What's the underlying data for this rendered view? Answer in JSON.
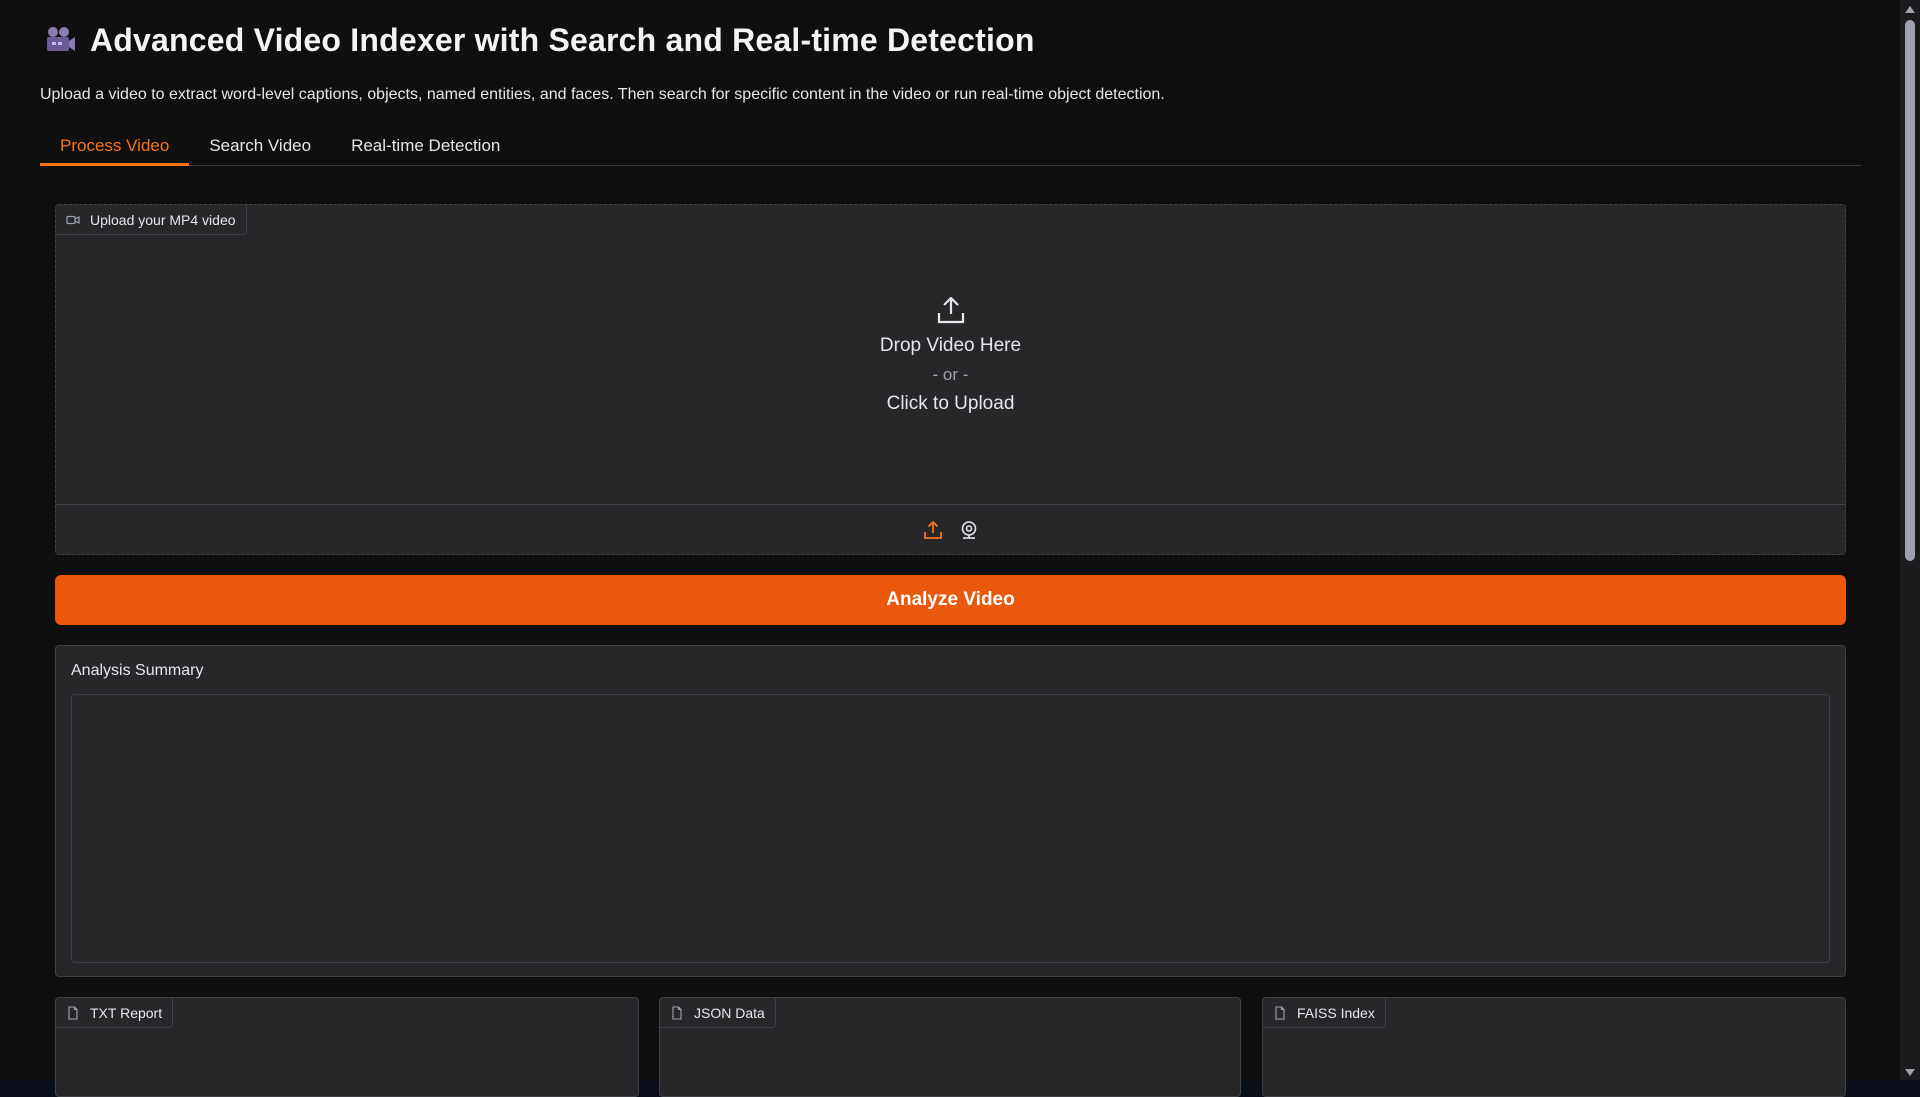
{
  "header": {
    "icon": "movie-camera-icon",
    "title": "Advanced Video Indexer with Search and Real-time Detection",
    "description": "Upload a video to extract word-level captions, objects, named entities, and faces. Then search for specific content in the video or run real-time object detection."
  },
  "tabs": [
    {
      "label": "Process Video",
      "active": true
    },
    {
      "label": "Search Video",
      "active": false
    },
    {
      "label": "Real-time Detection",
      "active": false
    }
  ],
  "upload": {
    "label": "Upload your MP4 video",
    "drop_text": "Drop Video Here",
    "or_text": "- or -",
    "click_text": "Click to Upload",
    "source_icons": [
      "upload-icon",
      "webcam-icon"
    ]
  },
  "analyze_button": {
    "label": "Analyze Video"
  },
  "summary": {
    "label": "Analysis Summary",
    "value": ""
  },
  "files": [
    {
      "label": "TXT Report",
      "icon": "file-icon"
    },
    {
      "label": "JSON Data",
      "icon": "file-icon"
    },
    {
      "label": "FAISS Index",
      "icon": "file-icon"
    }
  ],
  "colors": {
    "accent": "#ea580c",
    "accent_text": "#f97316",
    "background": "#0f0f10",
    "panel": "#27272a",
    "border": "#3f3f46"
  }
}
